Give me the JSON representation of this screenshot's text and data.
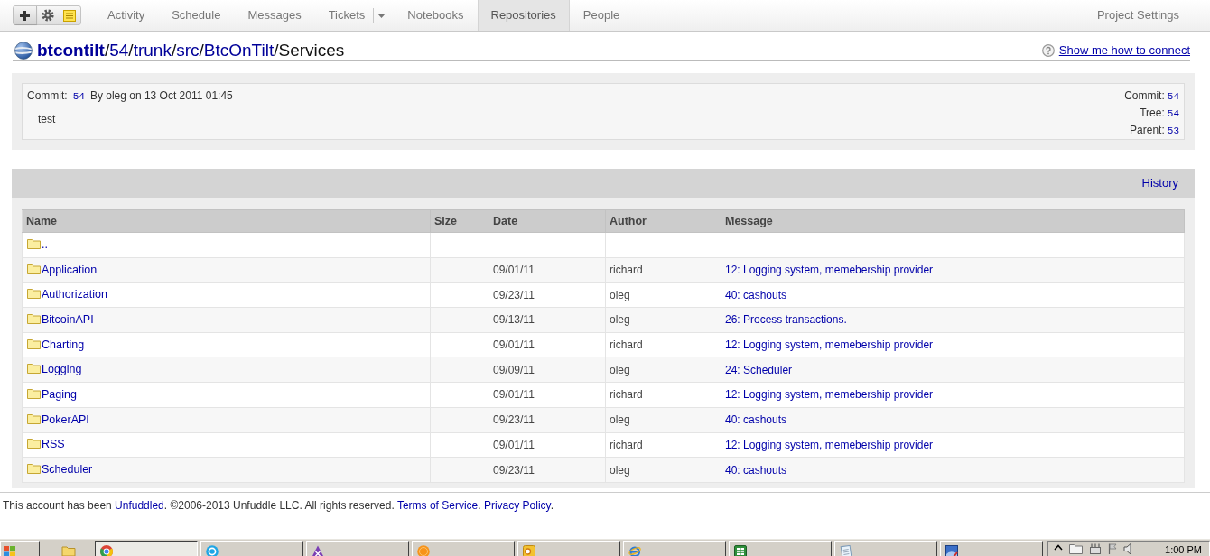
{
  "nav": {
    "tabs": [
      {
        "label": "Activity",
        "selected": false,
        "kind": "plain"
      },
      {
        "label": "Schedule",
        "selected": false,
        "kind": "plain"
      },
      {
        "label": "Messages",
        "selected": false,
        "kind": "plain"
      },
      {
        "label": "Tickets",
        "selected": false,
        "kind": "split"
      },
      {
        "label": "Notebooks",
        "selected": false,
        "kind": "plain"
      },
      {
        "label": "Repositories",
        "selected": true,
        "kind": "plain"
      },
      {
        "label": "People",
        "selected": false,
        "kind": "plain"
      }
    ],
    "settings": "Project Settings"
  },
  "breadcrumb": [
    {
      "kind": "root",
      "text": "btcontilt"
    },
    {
      "kind": "separator",
      "text": "/"
    },
    {
      "kind": "link",
      "text": "54"
    },
    {
      "kind": "separator",
      "text": "/"
    },
    {
      "kind": "link",
      "text": "trunk"
    },
    {
      "kind": "separator",
      "text": "/"
    },
    {
      "kind": "link",
      "text": "src"
    },
    {
      "kind": "separator",
      "text": "/"
    },
    {
      "kind": "link",
      "text": "BtcOnTilt"
    },
    {
      "kind": "separator",
      "text": "/"
    },
    {
      "kind": "current",
      "text": "Services"
    }
  ],
  "help_link": "Show me how to connect",
  "commit": {
    "label": "Commit:",
    "id": "54",
    "byline": "By oleg on 13 Oct 2011 01:45",
    "message": "test",
    "refs": [
      {
        "label": "Commit:",
        "value": "54"
      },
      {
        "label": "Tree:",
        "value": "54"
      },
      {
        "label": "Parent:",
        "value": "53"
      }
    ]
  },
  "files": {
    "history_link": "History",
    "columns": [
      "Name",
      "Size",
      "Date",
      "Author",
      "Message"
    ],
    "rows": [
      {
        "name": ".."
      },
      {
        "name": "Application",
        "date": "09/01/11",
        "author": "richard",
        "message": "12: Logging system, memebership provider"
      },
      {
        "name": "Authorization",
        "date": "09/23/11",
        "author": "oleg",
        "message": "40: cashouts"
      },
      {
        "name": "BitcoinAPI",
        "date": "09/13/11",
        "author": "oleg",
        "message": "26: Process transactions."
      },
      {
        "name": "Charting",
        "date": "09/01/11",
        "author": "richard",
        "message": "12: Logging system, memebership provider"
      },
      {
        "name": "Logging",
        "date": "09/09/11",
        "author": "oleg",
        "message": "24: Scheduler"
      },
      {
        "name": "Paging",
        "date": "09/01/11",
        "author": "richard",
        "message": "12: Logging system, memebership provider"
      },
      {
        "name": "PokerAPI",
        "date": "09/23/11",
        "author": "oleg",
        "message": "40: cashouts"
      },
      {
        "name": "RSS",
        "date": "09/01/11",
        "author": "richard",
        "message": "12: Logging system, memebership provider"
      },
      {
        "name": "Scheduler",
        "date": "09/23/11",
        "author": "oleg",
        "message": "40: cashouts"
      }
    ]
  },
  "footer": [
    {
      "kind": "text",
      "text": "This account has been "
    },
    {
      "kind": "link",
      "text": "Unfuddled"
    },
    {
      "kind": "text",
      "text": ". ©2006-2013 Unfuddle LLC. All rights reserved. "
    },
    {
      "kind": "link",
      "text": "Terms of Service"
    },
    {
      "kind": "text",
      "text": ". "
    },
    {
      "kind": "link",
      "text": "Privacy Policy"
    },
    {
      "kind": "text",
      "text": "."
    }
  ],
  "taskbar": {
    "windows": [
      {
        "kind": "segmented-circle",
        "selected": true
      },
      {
        "kind": "circle",
        "selected": false
      },
      {
        "kind": "triangle",
        "selected": false
      },
      {
        "kind": "coin",
        "selected": false
      },
      {
        "kind": "tile",
        "selected": false
      },
      {
        "kind": "orbit-globe",
        "selected": false
      },
      {
        "kind": "spreadsheet",
        "selected": false
      },
      {
        "kind": "notepad",
        "selected": false
      },
      {
        "kind": "picture",
        "selected": false
      }
    ],
    "clock": "1:00 PM"
  }
}
